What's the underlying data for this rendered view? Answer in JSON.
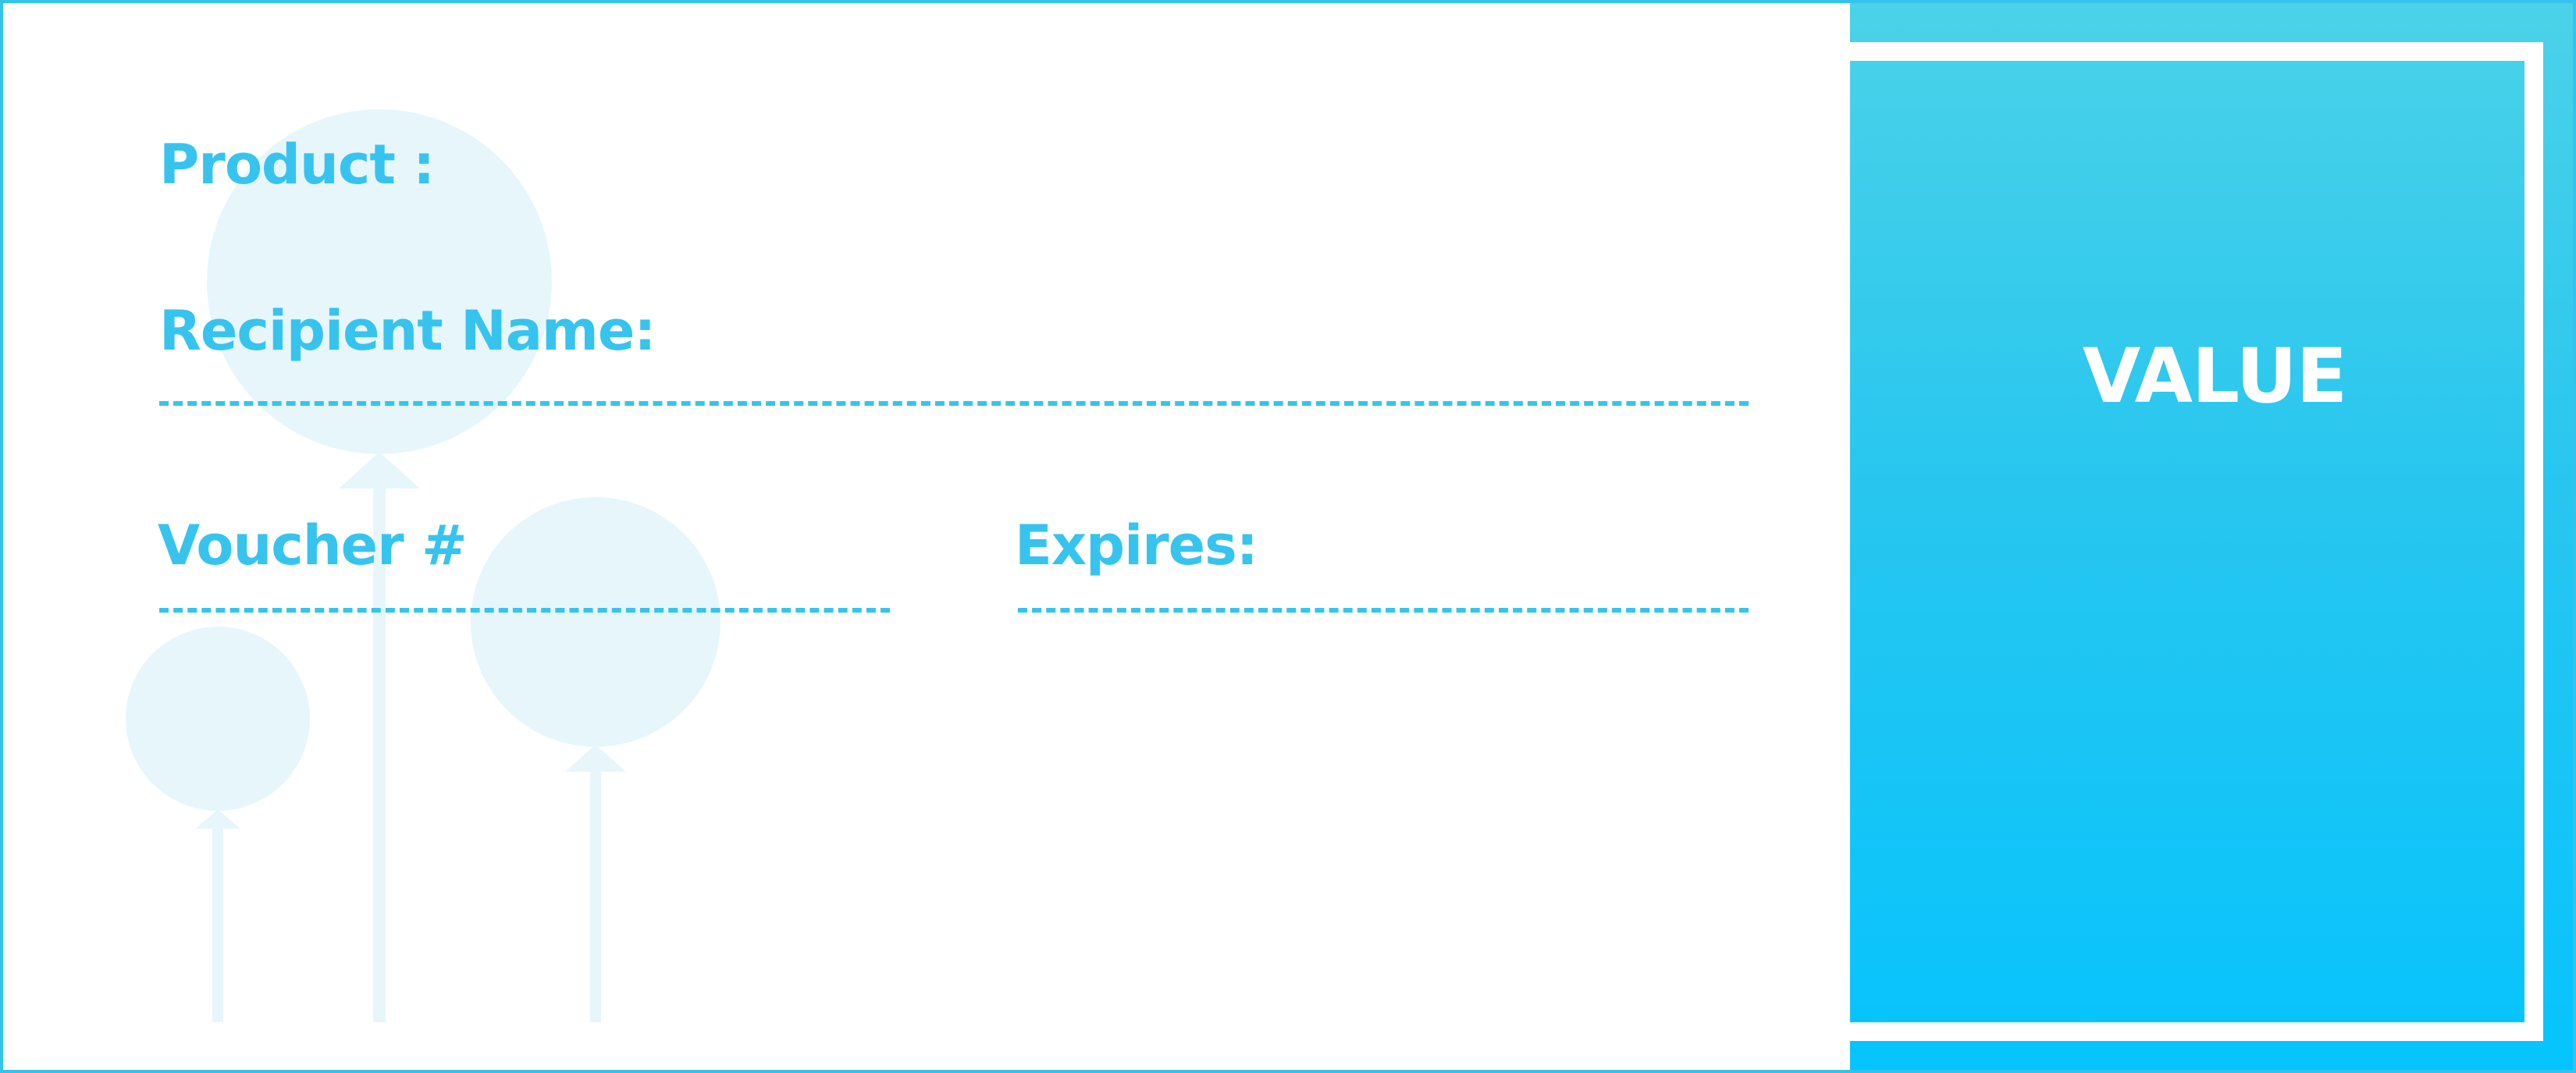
{
  "voucher": {
    "product_label": "Product :",
    "recipient_label": "Recipient Name:",
    "voucher_label": "Voucher #",
    "expires_label": "Expires:",
    "value_label": "VALUE"
  },
  "colors": {
    "accent": "#36c4ee",
    "frame": "#85def6",
    "panel_top": "#4bd2e8",
    "panel_bottom": "#05c4fd",
    "balloon": "#e6f6fb"
  },
  "decorations": {
    "background_icon": "balloons-icon"
  }
}
